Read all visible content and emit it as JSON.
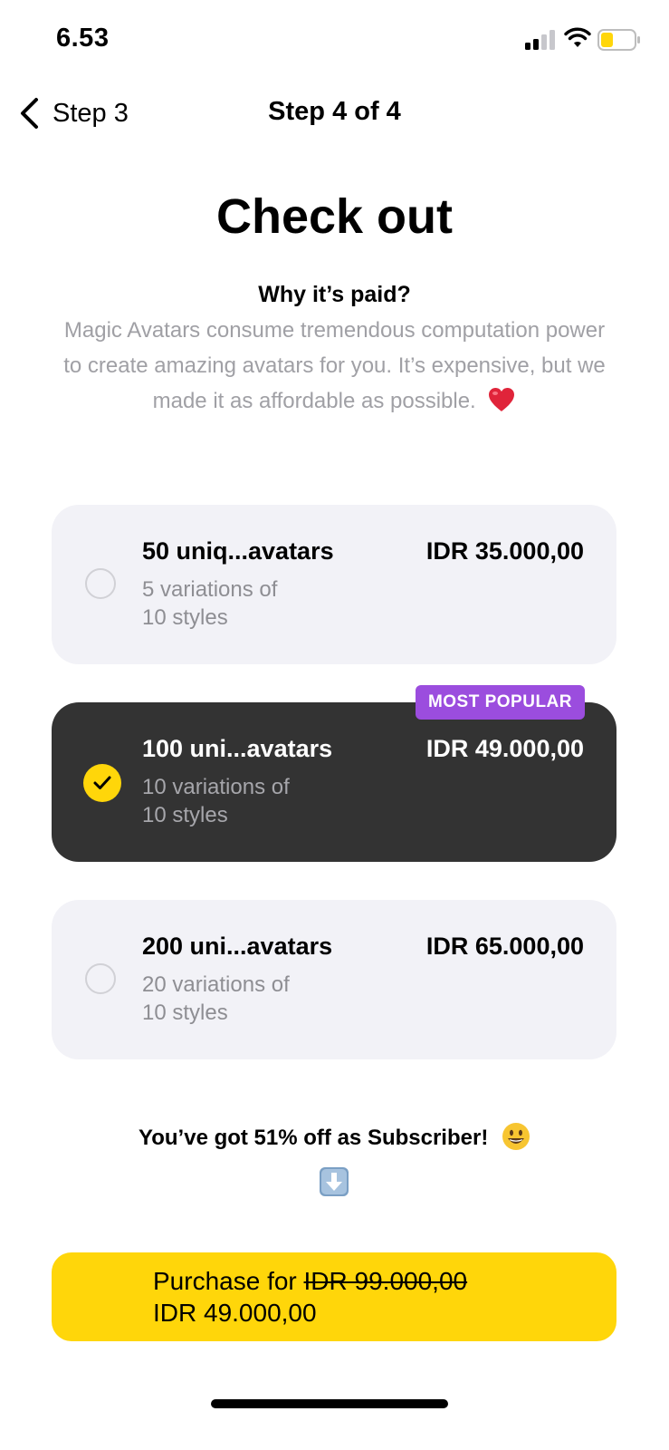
{
  "status_bar": {
    "time": "6.53",
    "battery_color": "#ffd60a"
  },
  "nav": {
    "back_label": "Step 3",
    "title": "Step 4 of 4"
  },
  "page": {
    "title": "Check out",
    "why_title": "Why it’s paid?",
    "why_body": "Magic Avatars consume tremendous computation power to create amazing avatars for you. It’s expensive, but we made it as affordable as possible."
  },
  "plans": [
    {
      "name": "50 uniq...avatars",
      "price": "IDR 35.000,00",
      "desc_line1": "5 variations of",
      "desc_line2": "10 styles",
      "selected": false
    },
    {
      "name": "100 uni...avatars",
      "price": "IDR 49.000,00",
      "desc_line1": "10 variations of",
      "desc_line2": "10 styles",
      "selected": true,
      "badge": "MOST POPULAR"
    },
    {
      "name": "200 uni...avatars",
      "price": "IDR 65.000,00",
      "desc_line1": "20 variations of",
      "desc_line2": "10 styles",
      "selected": false
    }
  ],
  "subscriber_note": "You’ve got 51% off as Subscriber!",
  "purchase": {
    "prefix": "Purchase for ",
    "old_price": "IDR 99.000,00",
    "new_price": "IDR 49.000,00"
  },
  "colors": {
    "accent_yellow": "#ffd60a",
    "badge_purple": "#9b4dde",
    "selected_card": "#333333",
    "card_bg": "#f2f2f7"
  },
  "icons": {
    "back": "chevron-left-icon",
    "signal": "cellular-signal-icon",
    "wifi": "wifi-icon",
    "battery": "battery-icon",
    "heart": "heart-emoji-icon",
    "smile": "smile-emoji-icon",
    "down_arrow": "down-arrow-emoji-icon",
    "check": "checkmark-icon"
  }
}
